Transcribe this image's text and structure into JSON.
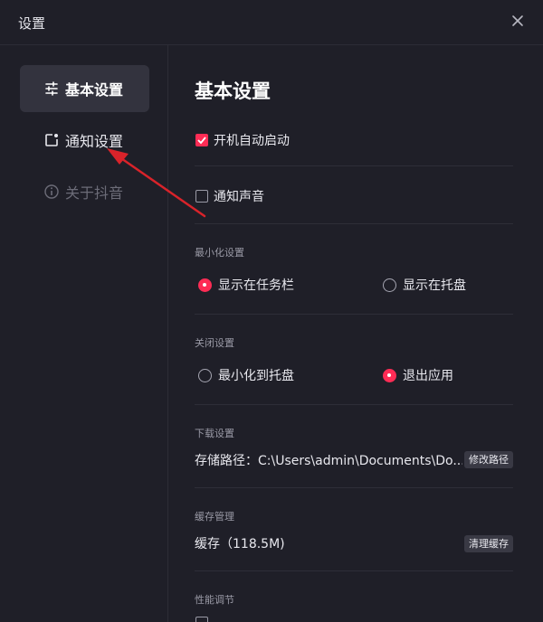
{
  "window": {
    "title": "设置"
  },
  "sidebar": {
    "items": [
      {
        "label": "基本设置",
        "icon": "sliders-icon",
        "active": true
      },
      {
        "label": "通知设置",
        "icon": "notification-icon",
        "active": false
      },
      {
        "label": "关于抖音",
        "icon": "info-icon",
        "active": false,
        "disabled": true
      }
    ]
  },
  "main": {
    "title": "基本设置",
    "auto_start": {
      "label": "开机自动启动",
      "checked": true
    },
    "notify_sound": {
      "label": "通知声音",
      "checked": false
    },
    "minimize": {
      "section": "最小化设置",
      "options": [
        {
          "label": "显示在任务栏",
          "selected": true
        },
        {
          "label": "显示在托盘",
          "selected": false
        }
      ]
    },
    "close": {
      "section": "关闭设置",
      "options": [
        {
          "label": "最小化到托盘",
          "selected": false
        },
        {
          "label": "退出应用",
          "selected": true
        }
      ]
    },
    "download": {
      "section": "下载设置",
      "path_text": "存储路径：C:\\Users\\admin\\Documents\\Do...",
      "button": "修改路径"
    },
    "cache": {
      "section": "缓存管理",
      "text": "缓存（118.5M)",
      "button": "清理缓存"
    },
    "performance": {
      "section": "性能调节"
    }
  },
  "colors": {
    "accent": "#fe2c55",
    "background": "#1f1f28",
    "annotation_arrow": "#d9232a"
  }
}
